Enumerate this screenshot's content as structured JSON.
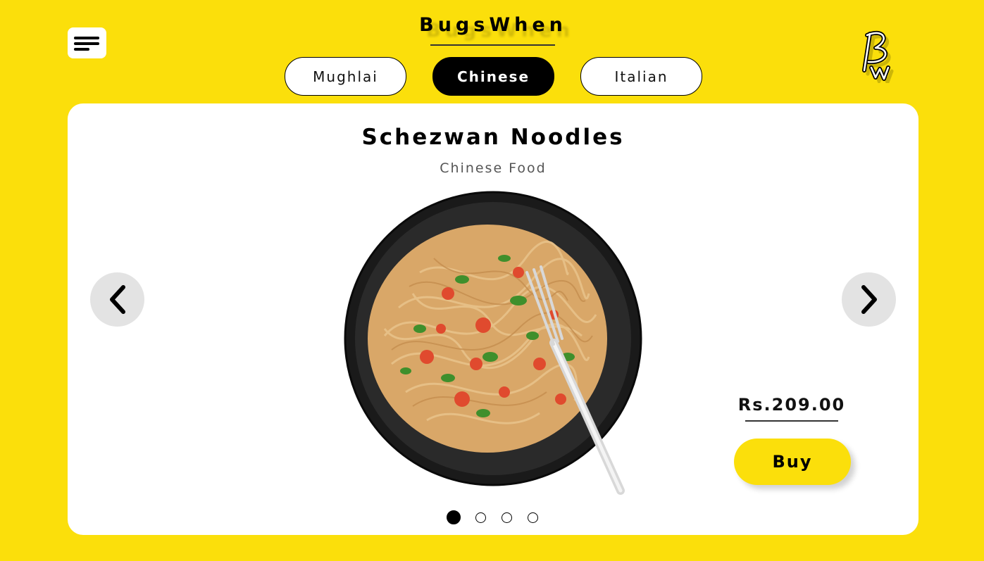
{
  "header": {
    "brand": "BugsWhen",
    "logo_icon": "bw-logo-icon",
    "menu_icon": "hamburger-menu-icon"
  },
  "tabs": [
    {
      "label": "Mughlai",
      "active": false
    },
    {
      "label": "Chinese",
      "active": true
    },
    {
      "label": "Italian",
      "active": false
    }
  ],
  "dish": {
    "title": "Schezwan Noodles",
    "subtitle": "Chinese Food",
    "image_icon": "noodles-bowl-image",
    "price": "Rs.209.00",
    "buy_label": "Buy"
  },
  "carousel": {
    "prev_icon": "chevron-left-icon",
    "next_icon": "chevron-right-icon",
    "slide_count": 4,
    "active_index": 0
  },
  "colors": {
    "background": "#fbdf0b",
    "card": "#ffffff",
    "accent": "#000000"
  }
}
